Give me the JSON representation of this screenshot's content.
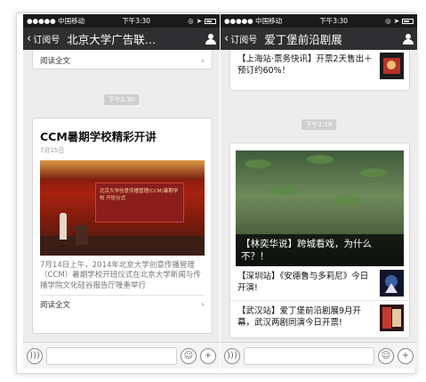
{
  "left_phone": {
    "status": {
      "signal": "●●●●● 中国移动",
      "time": "下午3:30"
    },
    "nav": {
      "back_label": "订阅号",
      "title": "北京大学广告联…"
    },
    "prev_card": {
      "read_all": "阅读全文"
    },
    "timestamp": "下午2:30",
    "article": {
      "title": "CCM暑期学校精彩开讲",
      "date": "7月15日",
      "banner_text": "北京大学创意传播管理(CCM)暑期学校 开班仪式",
      "summary": "7月14日上午，2014年北京大学创意传播管理（CCM）暑期学校开班仪式在北京大学新闻与传播学院文化硅谷报告厅隆重举行",
      "read_all": "阅读全文"
    }
  },
  "right_phone": {
    "status": {
      "signal": "●●●●● 中国移动",
      "time": "下午3:30"
    },
    "nav": {
      "back_label": "订阅号",
      "title": "爱丁堡前沿剧展"
    },
    "prev_card": {
      "text": "【上海站·票务快讯】开票2天售出＋预订约60%！"
    },
    "timestamp": "下午2:19",
    "hero": {
      "caption": "【林奕华说】跨城看戏，为什么不？！"
    },
    "news": [
      {
        "text": "【深圳站】《安德鲁与多莉尼》今日开演!"
      },
      {
        "text": "【武汉站】爱丁堡前沿剧展9月开幕，武汉两剧同演今日开票!"
      }
    ]
  },
  "colors": {
    "navbar": "#2f2f31",
    "statusbar": "#1a1a1a",
    "chat_bg": "#ededed",
    "time_pill": "#cfcfcf"
  },
  "icons": [
    "back-chevron-icon",
    "user-icon",
    "voice-icon",
    "emoji-icon",
    "plus-icon",
    "chevron-right-icon"
  ]
}
